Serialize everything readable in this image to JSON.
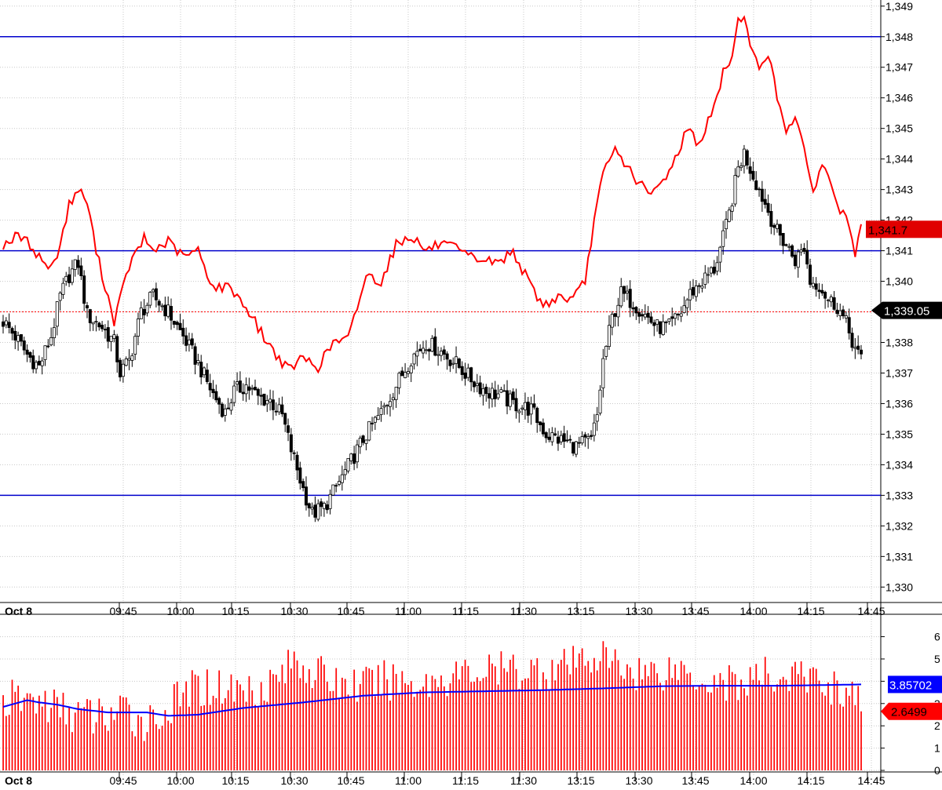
{
  "chart_data": [
    {
      "type": "candlestick",
      "panel": "price",
      "date_label": "Oct 8",
      "x_ticks": [
        "09:45",
        "10:00",
        "10:15",
        "10:30",
        "10:45",
        "11:00",
        "11:15",
        "11:30",
        "13:15",
        "13:30",
        "13:45",
        "14:00",
        "14:15",
        "14:45"
      ],
      "y_ticks": [
        "1,330",
        "1,331",
        "1,332",
        "1,333",
        "1,334",
        "1,335",
        "1,336",
        "1,337",
        "1,338",
        "1,339",
        "1,340",
        "1,341",
        "1,342",
        "1,343",
        "1,344",
        "1,345",
        "1,346",
        "1,347",
        "1,348",
        "1,349"
      ],
      "ylim": [
        1329.7,
        1349.2
      ],
      "grid": true,
      "horizontal_lines": [
        1348.0,
        1341.0,
        1333.0
      ],
      "reference_line": 1339.0,
      "last_price_label": "1,339.05",
      "overlay_last_label": "1,341.7",
      "colors": {
        "overlay": "#ff0000",
        "levels": "#0000cc",
        "up": "#ffffff",
        "down": "#000000",
        "last_price_bg": "#000000",
        "overlay_label_bg": "#e00000"
      },
      "overlay_anchors": [
        [
          0,
          1341.2
        ],
        [
          5,
          1341.5
        ],
        [
          9,
          1341.2
        ],
        [
          12,
          1340.8
        ],
        [
          16,
          1340.4
        ],
        [
          19,
          1341.2
        ],
        [
          22,
          1342.5
        ],
        [
          25,
          1343.0
        ],
        [
          28,
          1342.6
        ],
        [
          31,
          1341.0
        ],
        [
          37,
          1338.7
        ],
        [
          42,
          1340.5
        ],
        [
          47,
          1341.4
        ],
        [
          50,
          1341.0
        ],
        [
          55,
          1341.3
        ],
        [
          60,
          1340.8
        ],
        [
          65,
          1341.0
        ],
        [
          70,
          1339.8
        ],
        [
          76,
          1339.8
        ],
        [
          82,
          1339.0
        ],
        [
          88,
          1338.0
        ],
        [
          95,
          1337.1
        ],
        [
          100,
          1337.5
        ],
        [
          105,
          1337.2
        ],
        [
          110,
          1338.0
        ],
        [
          115,
          1338.1
        ],
        [
          121,
          1340.2
        ],
        [
          126,
          1340.0
        ],
        [
          131,
          1341.2
        ],
        [
          136,
          1341.5
        ],
        [
          141,
          1341.0
        ],
        [
          145,
          1341.2
        ],
        [
          150,
          1341.1
        ],
        [
          155,
          1340.8
        ],
        [
          160,
          1340.7
        ],
        [
          165,
          1340.6
        ],
        [
          170,
          1341.0
        ],
        [
          175,
          1340.0
        ],
        [
          180,
          1339.2
        ],
        [
          185,
          1339.5
        ],
        [
          190,
          1339.4
        ],
        [
          194,
          1340.0
        ],
        [
          197,
          1342.0
        ],
        [
          200,
          1343.5
        ],
        [
          204,
          1344.3
        ],
        [
          207,
          1343.9
        ],
        [
          212,
          1343.2
        ],
        [
          216,
          1342.8
        ],
        [
          220,
          1343.3
        ],
        [
          224,
          1344.0
        ],
        [
          228,
          1345.0
        ],
        [
          232,
          1344.5
        ],
        [
          235,
          1345.2
        ],
        [
          238,
          1346.0
        ],
        [
          240,
          1346.8
        ],
        [
          243,
          1347.4
        ],
        [
          245,
          1348.5
        ],
        [
          247,
          1348.8
        ],
        [
          249,
          1347.6
        ],
        [
          252,
          1347.0
        ],
        [
          255,
          1347.5
        ],
        [
          258,
          1346.0
        ],
        [
          261,
          1345.0
        ],
        [
          264,
          1345.4
        ],
        [
          267,
          1344.2
        ],
        [
          270,
          1343.0
        ],
        [
          273,
          1343.8
        ],
        [
          276,
          1343.2
        ],
        [
          279,
          1342.3
        ],
        [
          282,
          1341.9
        ],
        [
          284,
          1340.8
        ],
        [
          286,
          1341.7
        ]
      ],
      "candle_anchors": [
        [
          0,
          1338.7
        ],
        [
          4,
          1338.2
        ],
        [
          8,
          1337.6
        ],
        [
          12,
          1337.2
        ],
        [
          16,
          1338.2
        ],
        [
          19,
          1339.5
        ],
        [
          22,
          1340.2
        ],
        [
          25,
          1340.6
        ],
        [
          28,
          1338.9
        ],
        [
          33,
          1338.5
        ],
        [
          37,
          1338.0
        ],
        [
          39,
          1337.0
        ],
        [
          42,
          1337.4
        ],
        [
          46,
          1339.0
        ],
        [
          50,
          1339.5
        ],
        [
          55,
          1339.0
        ],
        [
          60,
          1338.2
        ],
        [
          65,
          1337.3
        ],
        [
          70,
          1336.3
        ],
        [
          74,
          1335.7
        ],
        [
          77,
          1336.4
        ],
        [
          81,
          1336.6
        ],
        [
          85,
          1336.2
        ],
        [
          89,
          1336.1
        ],
        [
          93,
          1335.6
        ],
        [
          96,
          1334.5
        ],
        [
          100,
          1333.2
        ],
        [
          103,
          1332.4
        ],
        [
          107,
          1332.6
        ],
        [
          110,
          1333.1
        ],
        [
          113,
          1333.6
        ],
        [
          117,
          1334.3
        ],
        [
          121,
          1335.0
        ],
        [
          126,
          1335.7
        ],
        [
          131,
          1336.6
        ],
        [
          136,
          1337.5
        ],
        [
          141,
          1338.0
        ],
        [
          146,
          1337.7
        ],
        [
          151,
          1337.3
        ],
        [
          156,
          1336.8
        ],
        [
          161,
          1336.4
        ],
        [
          165,
          1336.3
        ],
        [
          170,
          1336.0
        ],
        [
          176,
          1335.8
        ],
        [
          181,
          1335.0
        ],
        [
          186,
          1334.8
        ],
        [
          191,
          1334.6
        ],
        [
          196,
          1334.8
        ],
        [
          198,
          1335.6
        ],
        [
          200,
          1337.4
        ],
        [
          203,
          1338.8
        ],
        [
          206,
          1339.6
        ],
        [
          210,
          1339.3
        ],
        [
          214,
          1338.9
        ],
        [
          218,
          1338.5
        ],
        [
          222,
          1338.5
        ],
        [
          226,
          1339.0
        ],
        [
          229,
          1339.6
        ],
        [
          233,
          1340.0
        ],
        [
          237,
          1340.4
        ],
        [
          240,
          1341.4
        ],
        [
          242,
          1342.2
        ],
        [
          245,
          1343.7
        ],
        [
          247,
          1344.2
        ],
        [
          249,
          1343.7
        ],
        [
          252,
          1343.0
        ],
        [
          255,
          1342.3
        ],
        [
          258,
          1341.6
        ],
        [
          261,
          1341.2
        ],
        [
          264,
          1340.7
        ],
        [
          267,
          1341.1
        ],
        [
          269,
          1340.0
        ],
        [
          272,
          1339.9
        ],
        [
          275,
          1339.4
        ],
        [
          278,
          1339.2
        ],
        [
          281,
          1338.6
        ],
        [
          284,
          1337.8
        ],
        [
          286,
          1337.4
        ]
      ]
    },
    {
      "type": "bar",
      "panel": "volume",
      "date_label": "Oct 8",
      "x_ticks": [
        "09:45",
        "10:00",
        "10:15",
        "10:30",
        "10:45",
        "11:00",
        "11:15",
        "11:30",
        "13:15",
        "13:30",
        "13:45",
        "14:00",
        "14:15",
        "14:45"
      ],
      "y_ticks": [
        "0",
        "1",
        "2",
        "3",
        "4",
        "5",
        "6"
      ],
      "ylim": [
        0,
        6.9
      ],
      "grid": true,
      "ma_last_label": "3.85702",
      "last_bar_label": "2.6499",
      "colors": {
        "bars": "#ff0000",
        "ma": "#0000ff",
        "ma_label_bg": "#0000ff",
        "bar_label_bg": "#ff0000"
      },
      "bar_anchors": [
        [
          0,
          3.1
        ],
        [
          10,
          3.2
        ],
        [
          20,
          2.7
        ],
        [
          30,
          2.4
        ],
        [
          40,
          2.6
        ],
        [
          48,
          2.2
        ],
        [
          55,
          2.7
        ],
        [
          62,
          3.6
        ],
        [
          70,
          3.8
        ],
        [
          80,
          3.6
        ],
        [
          90,
          4.0
        ],
        [
          98,
          5.0
        ],
        [
          105,
          4.3
        ],
        [
          112,
          3.9
        ],
        [
          120,
          3.8
        ],
        [
          130,
          4.1
        ],
        [
          140,
          3.9
        ],
        [
          150,
          4.3
        ],
        [
          160,
          4.4
        ],
        [
          170,
          4.5
        ],
        [
          180,
          4.5
        ],
        [
          190,
          4.7
        ],
        [
          197,
          5.2
        ],
        [
          205,
          4.7
        ],
        [
          215,
          4.4
        ],
        [
          225,
          4.6
        ],
        [
          235,
          4.1
        ],
        [
          245,
          3.9
        ],
        [
          255,
          4.2
        ],
        [
          265,
          4.2
        ],
        [
          275,
          3.9
        ],
        [
          286,
          3.2
        ]
      ],
      "ma_anchors": [
        [
          0,
          2.85
        ],
        [
          4,
          3.0
        ],
        [
          8,
          3.15
        ],
        [
          12,
          3.05
        ],
        [
          18,
          2.95
        ],
        [
          25,
          2.75
        ],
        [
          35,
          2.6
        ],
        [
          48,
          2.6
        ],
        [
          55,
          2.45
        ],
        [
          65,
          2.5
        ],
        [
          80,
          2.8
        ],
        [
          100,
          3.05
        ],
        [
          120,
          3.35
        ],
        [
          140,
          3.5
        ],
        [
          160,
          3.55
        ],
        [
          180,
          3.6
        ],
        [
          200,
          3.68
        ],
        [
          220,
          3.78
        ],
        [
          240,
          3.8
        ],
        [
          260,
          3.8
        ],
        [
          286,
          3.857
        ]
      ]
    }
  ]
}
